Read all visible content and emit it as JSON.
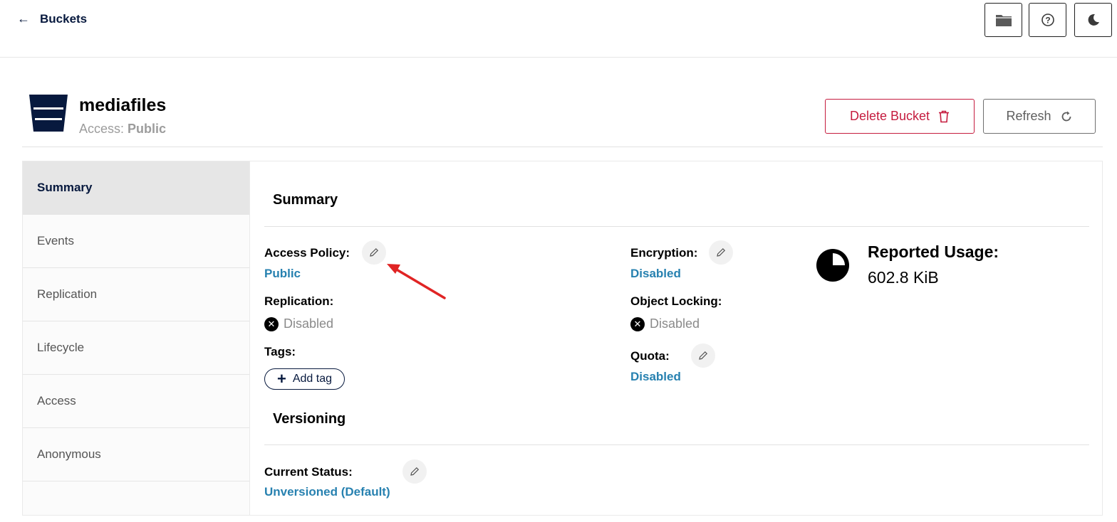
{
  "nav": {
    "back_label": "Buckets"
  },
  "toolbar_icons": [
    "folder-icon",
    "help-icon",
    "dark-mode-icon"
  ],
  "bucket": {
    "name": "mediafiles",
    "access_label": "Access:",
    "access_value": "Public"
  },
  "actions": {
    "delete_label": "Delete Bucket",
    "refresh_label": "Refresh"
  },
  "sidebar": {
    "items": [
      {
        "label": "Summary",
        "active": true
      },
      {
        "label": "Events"
      },
      {
        "label": "Replication"
      },
      {
        "label": "Lifecycle"
      },
      {
        "label": "Access"
      },
      {
        "label": "Anonymous"
      }
    ]
  },
  "summary": {
    "title": "Summary",
    "access_policy": {
      "label": "Access Policy:",
      "value": "Public"
    },
    "replication": {
      "label": "Replication:",
      "value": "Disabled"
    },
    "tags": {
      "label": "Tags:",
      "add_label": "Add tag"
    },
    "encryption": {
      "label": "Encryption:",
      "value": "Disabled"
    },
    "object_locking": {
      "label": "Object Locking:",
      "value": "Disabled"
    },
    "quota": {
      "label": "Quota:",
      "value": "Disabled"
    },
    "usage": {
      "label": "Reported Usage:",
      "value": "602.8 KiB",
      "pie_filled_fraction": 0.75
    }
  },
  "versioning": {
    "title": "Versioning",
    "current_status": {
      "label": "Current Status:",
      "value": "Unversioned (Default)"
    }
  },
  "colors": {
    "primary": "#07193e",
    "link": "#2781b0",
    "danger": "#c51b3e",
    "annotation": "#e02424"
  }
}
